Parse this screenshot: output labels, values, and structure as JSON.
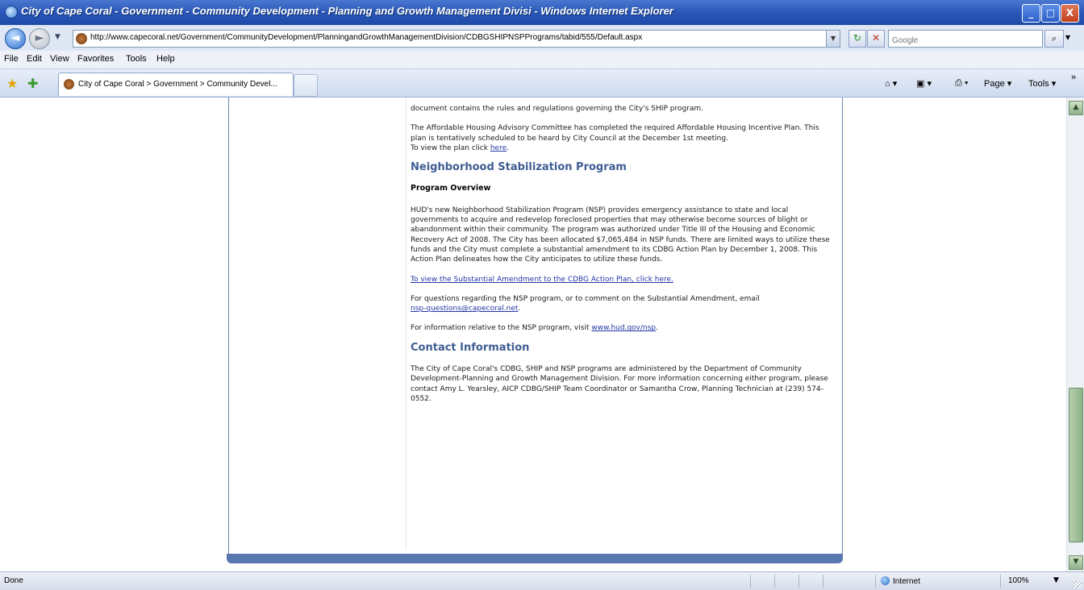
{
  "window": {
    "title": "City of Cape Coral - Government - Community Development - Planning and Growth Management Divisi - Windows Internet Explorer",
    "min": "_",
    "max": "□",
    "close": "X"
  },
  "address": {
    "url": "http://www.capecoral.net/Government/CommunityDevelopment/PlanningandGrowthManagementDivision/CDBGSHIPNSPPrograms/tabid/555/Default.aspx",
    "search_placeholder": "Google",
    "back": "◄",
    "forward": "►",
    "refresh": "↻",
    "stop": "✕",
    "search_go": "⌕"
  },
  "menu": [
    "File",
    "Edit",
    "View",
    "Favorites",
    "Tools",
    "Help"
  ],
  "tabs": {
    "active_label": "City of Cape Coral > Government > Community Devel..."
  },
  "commands": {
    "home": "⌂ ▾",
    "feeds": "▣ ▾",
    "print": "⎙ ▾",
    "page": "Page ▾",
    "tools": "Tools ▾",
    "more": "»"
  },
  "article": {
    "p_ship_rules": "document contains the rules and regulations governing the City's SHIP program.",
    "p_ahac": "The Affordable Housing Advisory Committee has completed the required Affordable Housing Incentive Plan.  This plan is tentatively scheduled to be heard by City Council at the December 1st meeting.",
    "view_plan_prefix": "To view the plan click ",
    "view_plan_link": "here",
    "view_plan_suffix": ".",
    "h_nsp": "Neighborhood Stabilization Program",
    "h_overview": "Program Overview",
    "p_nsp": "HUD's new Neighborhood Stabilization Program (NSP) provides emergency assistance to state and local governments to acquire and redevelop foreclosed properties that may otherwise become sources of blight or abandonment within their community.  The program was authorized under Title III of the Housing and Economic Recovery Act of 2008.  The City has been allocated $7,065,484 in NSP funds.  There are limited ways to utilize these funds and the City must complete a substantial amendment to its CDBG Action Plan by December 1, 2008.  This Action Plan delineates how the City anticipates to utilize these funds.",
    "link_amendment": "To view the Substantial Amendment to the CDBG Action Plan, click here.",
    "p_questions": "For questions regarding the NSP program, or to comment on the Substantial Amendment, email",
    "email_link": "nsp-questions@capecoral.net",
    "email_suffix": ".",
    "info_prefix": "For information relative to the NSP program, visit ",
    "hud_link": "www.hud.gov/nsp",
    "info_suffix": ".",
    "h_contact": "Contact Information",
    "p_contact": "The City of Cape Coral's CDBG, SHIP and NSP programs are administered by the Department of Community Development-Planning and Growth Management Division. For more information concerning either program, please contact Amy L. Yearsley, AICP CDBG/SHIP Team Coordinator or Samantha Crow, Planning Technician at (239) 574-0552."
  },
  "status": {
    "left": "Done",
    "zone": "Internet",
    "zoom": "100%"
  }
}
